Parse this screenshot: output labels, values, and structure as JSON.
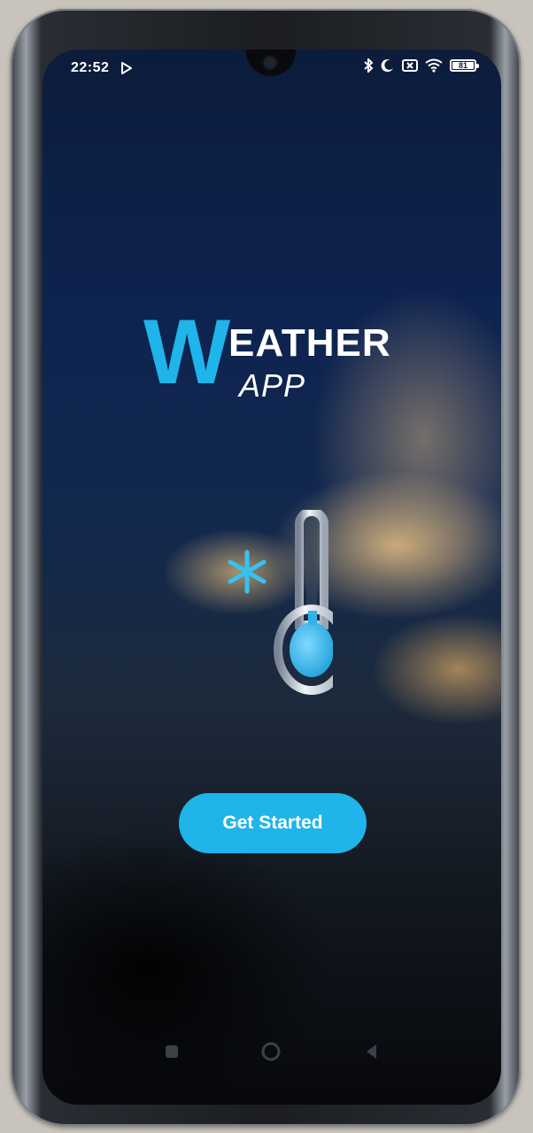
{
  "status_bar": {
    "time": "22:52",
    "battery_level": "81"
  },
  "logo": {
    "initial": "W",
    "rest": "EATHER",
    "sub": "APP"
  },
  "actions": {
    "get_started_label": "Get Started"
  },
  "colors": {
    "accent": "#1fb4ea",
    "text": "#ffffff"
  },
  "icons": {
    "illustration": "thermometer-snowflake-icon",
    "nav": [
      "recent-apps-icon",
      "home-icon",
      "back-icon"
    ]
  }
}
